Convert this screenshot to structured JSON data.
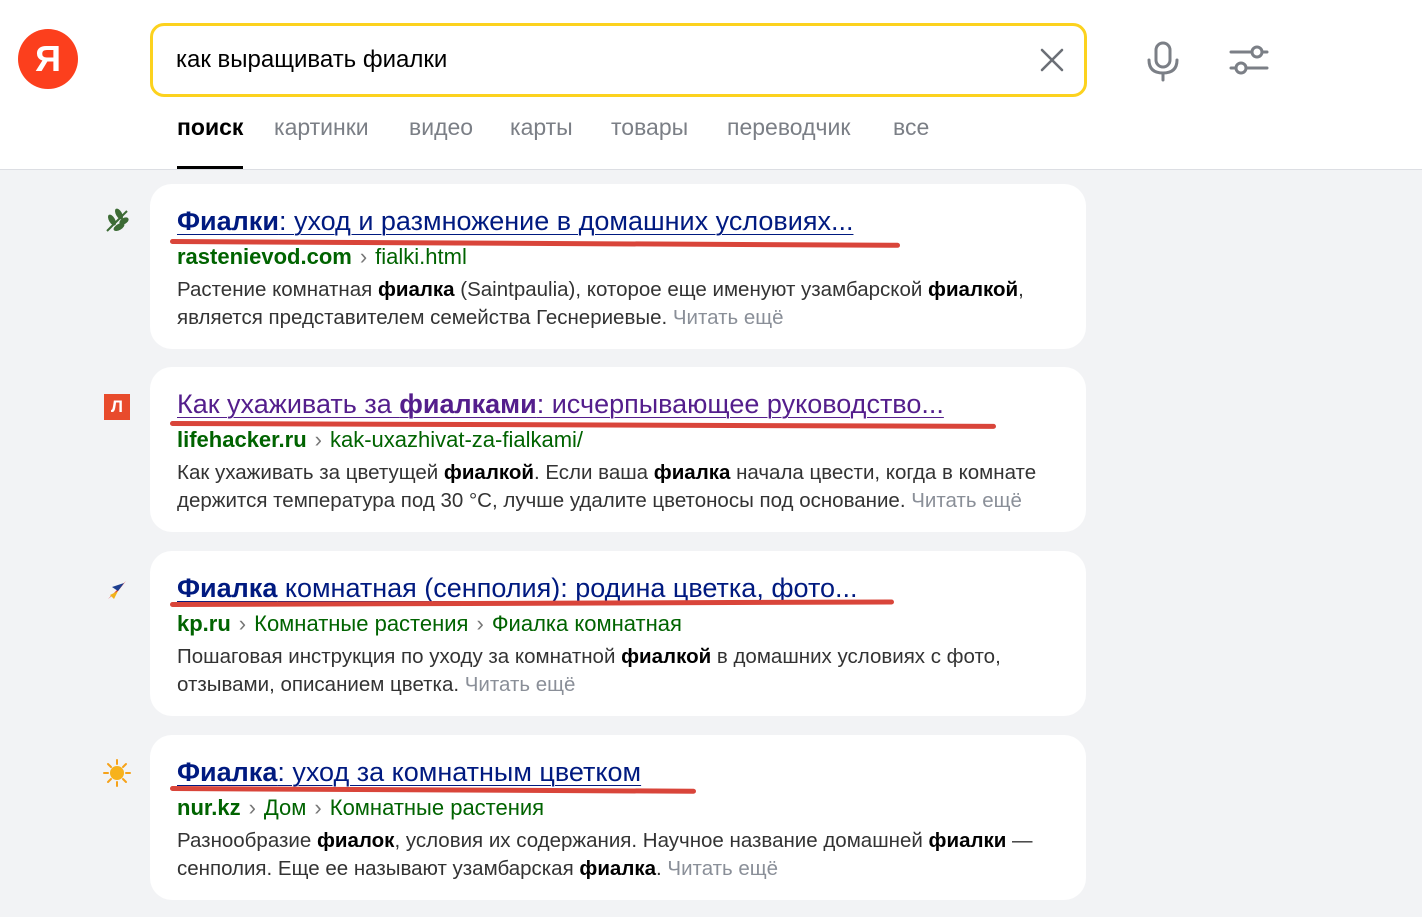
{
  "logo": {
    "letter": "Я"
  },
  "search": {
    "query": "как выращивать фиалки"
  },
  "tabs": [
    {
      "label": "поиск",
      "active": true
    },
    {
      "label": "картинки"
    },
    {
      "label": "видео"
    },
    {
      "label": "карты"
    },
    {
      "label": "товары"
    },
    {
      "label": "переводчик"
    },
    {
      "label": "все"
    }
  ],
  "results": [
    {
      "title_bold": "Фиалки",
      "title_rest": ": уход и размножение в домашних условиях...",
      "host": "rastenievod.com",
      "crumbs": [
        "fialki.html"
      ],
      "snippet": [
        {
          "t": "Растение комнатная "
        },
        {
          "b": "фиалка"
        },
        {
          "t": " (Saintpaulia), которое еще именуют узамбарской "
        },
        {
          "b": "фиалкой"
        },
        {
          "t": ", является представителем семейства Геснериевые. "
        }
      ],
      "read_more": "Читать ещё",
      "favicon": "leaf-icon"
    },
    {
      "title_pre": "Как ухаживать за ",
      "title_bold": "фиалками",
      "title_rest": ": исчерпывающее руководство...",
      "host": "lifehacker.ru",
      "crumbs": [
        "kak-uxazhivat-za-fialkami/"
      ],
      "snippet": [
        {
          "t": "Как ухаживать за цветущей "
        },
        {
          "b": "фиалкой"
        },
        {
          "t": ". Если ваша "
        },
        {
          "b": "фиалка"
        },
        {
          "t": " начала цвести, когда в комнате держится температура под 30 °C, лучше удалите цветоносы под основание. "
        }
      ],
      "read_more": "Читать ещё",
      "favicon": "lifehacker-icon",
      "favicon_letter": "Л"
    },
    {
      "title_bold": "Фиалка",
      "title_rest": " комнатная (сенполия): родина цветка, фото...",
      "host": "kp.ru",
      "crumbs": [
        "Комнатные растения",
        "Фиалка комнатная"
      ],
      "snippet": [
        {
          "t": "Пошаговая инструкция по уходу за комнатной "
        },
        {
          "b": "фиалкой"
        },
        {
          "t": " в домашних условиях с фото, отзывами, описанием цветка. "
        }
      ],
      "read_more": "Читать ещё",
      "favicon": "bird-icon"
    },
    {
      "title_bold": "Фиалка",
      "title_rest": ": уход за комнатным цветком",
      "host": "nur.kz",
      "crumbs": [
        "Дом",
        "Комнатные растения"
      ],
      "snippet": [
        {
          "t": "Разнообразие "
        },
        {
          "b": "фиалок"
        },
        {
          "t": ", условия их содержания. Научное название домашней "
        },
        {
          "b": "фиалки"
        },
        {
          "t": " — сенполия. Еще ее называют узамбарская "
        },
        {
          "b": "фиалка"
        },
        {
          "t": ". "
        }
      ],
      "read_more": "Читать ещё",
      "favicon": "sun-icon"
    }
  ],
  "colors": {
    "accent": "#fc3f1d",
    "search_border": "#fcd21e",
    "link": "#001a80",
    "visited_link": "#541e8c",
    "url_green": "#006300",
    "annotation_red": "#d9453a"
  }
}
